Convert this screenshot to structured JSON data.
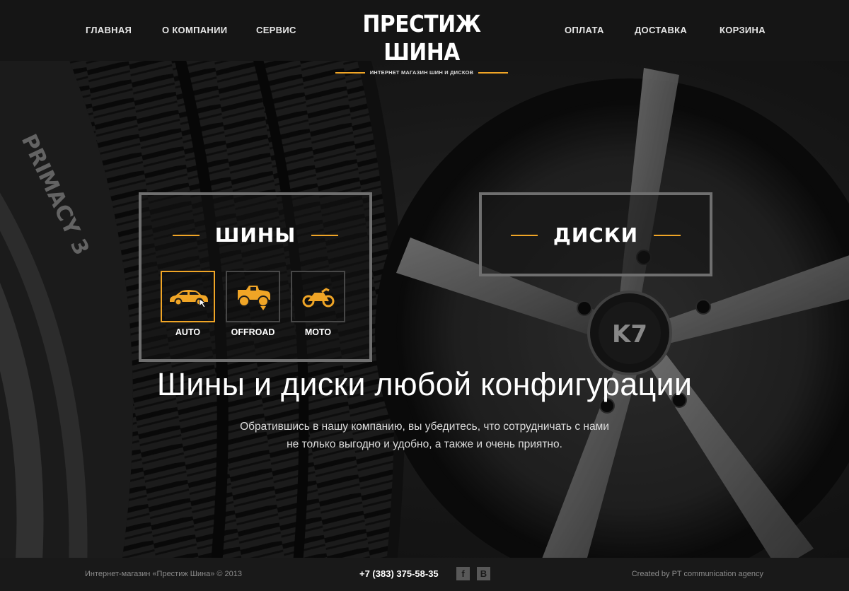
{
  "nav": {
    "left": [
      "ГЛАВНАЯ",
      "О КОМПАНИИ",
      "СЕРВИС"
    ],
    "right": [
      "ОПЛАТА",
      "ДОСТАВКА",
      "КОРЗИНА"
    ]
  },
  "logo": {
    "title": "ПРЕСТИЖ ШИНА",
    "subtitle": "ИНТЕРНЕТ МАГАЗИН ШИН И ДИСКОВ"
  },
  "tires_card": {
    "title": "ШИНЫ",
    "categories": [
      {
        "label": "AUTO",
        "icon": "car-icon",
        "active": true
      },
      {
        "label": "OFFROAD",
        "icon": "offroad-truck-icon",
        "active": false
      },
      {
        "label": "MOTO",
        "icon": "motorcycle-icon",
        "active": false
      }
    ]
  },
  "wheels_card": {
    "title": "ДИСКИ"
  },
  "hero_art": {
    "wheel_badge": "K7",
    "tire_sidewall_text": "PRIMACY 3"
  },
  "hero": {
    "headline": "Шины и диски любой конфигурации",
    "desc_line1": "Обратившись в нашу компанию, вы убедитесь, что сотрудничать с нами",
    "desc_line2": "не только выгодно и удобно, а также и очень приятно."
  },
  "footer": {
    "copyright": "Интернет-магазин «Престиж Шина» © 2013",
    "phone": "+7 (383) 375-58-35",
    "social": [
      "f",
      "B"
    ],
    "credit": "Created by PT communication agency"
  },
  "colors": {
    "accent": "#f0a526",
    "header_bg": "#151515",
    "footer_bg": "#191919"
  }
}
